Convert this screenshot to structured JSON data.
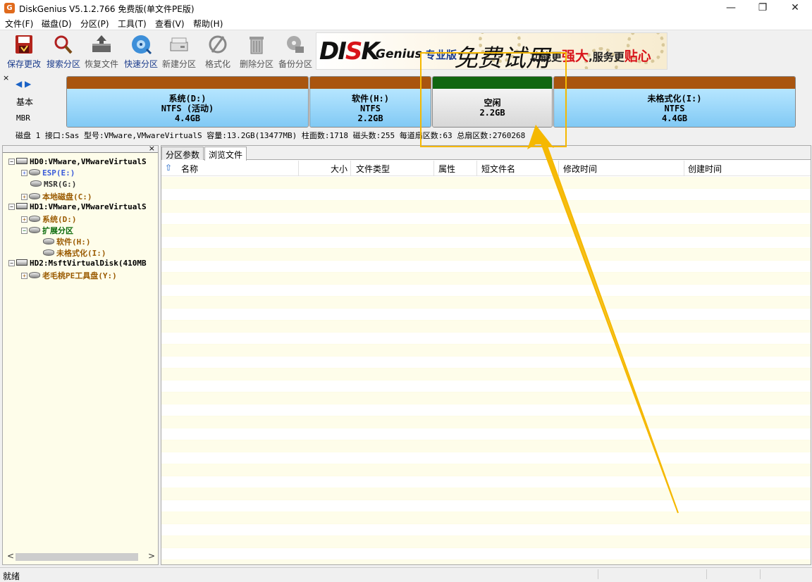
{
  "window": {
    "title": "DiskGenius V5.1.2.766 免费版(单文件PE版)",
    "app_icon": "G",
    "minimize": "—",
    "maximize": "❐",
    "close": "✕"
  },
  "menu": [
    "文件(F)",
    "磁盘(D)",
    "分区(P)",
    "工具(T)",
    "查看(V)",
    "帮助(H)"
  ],
  "toolbar": [
    {
      "label": "保存更改",
      "icon": "save-icon",
      "enabled": true
    },
    {
      "label": "搜索分区",
      "icon": "search-partition-icon",
      "enabled": true
    },
    {
      "label": "恢复文件",
      "icon": "recover-files-icon",
      "enabled": false
    },
    {
      "label": "快速分区",
      "icon": "quick-partition-icon",
      "enabled": true
    },
    {
      "label": "新建分区",
      "icon": "new-partition-icon",
      "enabled": false
    },
    {
      "label": "格式化",
      "icon": "format-icon",
      "enabled": false
    },
    {
      "label": "删除分区",
      "icon": "delete-partition-icon",
      "enabled": false
    },
    {
      "label": "备份分区",
      "icon": "backup-partition-icon",
      "enabled": false
    }
  ],
  "banner": {
    "logo_a": "DI",
    "logo_b": "S",
    "logo_c": "K",
    "genius": "Genius",
    "pro": "专业版",
    "trial": "免费试用",
    "slogan_a": "功能更",
    "slogan_b": "强大",
    "slogan_c": ",服务更",
    "slogan_d": "贴心"
  },
  "diskbar": {
    "close": "×",
    "nav": "◀ ▶",
    "type": "基本",
    "scheme": "MBR",
    "partitions": [
      {
        "name": "系统(D:)",
        "fs": "NTFS (活动)",
        "size": "4.4GB",
        "color": "#a9550f"
      },
      {
        "name": "软件(H:)",
        "fs": "NTFS",
        "size": "2.2GB",
        "color": "#a9550f"
      },
      {
        "name": "空闲",
        "size": "2.2GB",
        "color": "#116611"
      },
      {
        "name": "未格式化(I:)",
        "fs": "NTFS",
        "size": "4.4GB",
        "color": "#a9550f"
      }
    ],
    "info": "磁盘 1 接口:Sas  型号:VMware,VMwareVirtualS  容量:13.2GB(13477MB)  柱面数:1718  磁头数:255  每道扇区数:63  总扇区数:2760268"
  },
  "tree": {
    "close": "×",
    "items": [
      {
        "text": "HD0:VMware,VMwareVirtualS",
        "exp": "−",
        "kind": "disk",
        "color": "#000000"
      },
      {
        "text": "ESP(E:)",
        "exp": "+",
        "kind": "part",
        "color": "#3a5bd9"
      },
      {
        "text": "MSR(G:)",
        "exp": "",
        "kind": "part",
        "color": "#333333"
      },
      {
        "text": "本地磁盘(C:)",
        "exp": "+",
        "kind": "part",
        "color": "#9a5a00"
      },
      {
        "text": "HD1:VMware,VMwareVirtualS",
        "exp": "−",
        "kind": "disk",
        "color": "#000000"
      },
      {
        "text": "系统(D:)",
        "exp": "+",
        "kind": "part",
        "color": "#9a5a00"
      },
      {
        "text": "扩展分区",
        "exp": "−",
        "kind": "ext",
        "color": "#0b6b0b"
      },
      {
        "text": "软件(H:)",
        "exp": "",
        "kind": "part",
        "color": "#9a5a00"
      },
      {
        "text": "未格式化(I:)",
        "exp": "",
        "kind": "part",
        "color": "#9a5a00"
      },
      {
        "text": "HD2:MsftVirtualDisk(410MB",
        "exp": "−",
        "kind": "disk",
        "color": "#000000"
      },
      {
        "text": "老毛桃PE工具盘(Y:)",
        "exp": "+",
        "kind": "part",
        "color": "#9a5a00"
      }
    ],
    "scroll_left": "<",
    "scroll_right": ">"
  },
  "tabs": [
    "分区参数",
    "浏览文件"
  ],
  "columns": [
    "名称",
    "大小",
    "文件类型",
    "属性",
    "短文件名",
    "修改时间",
    "创建时间"
  ],
  "status": "就绪",
  "annotation_color": "#f5b800"
}
